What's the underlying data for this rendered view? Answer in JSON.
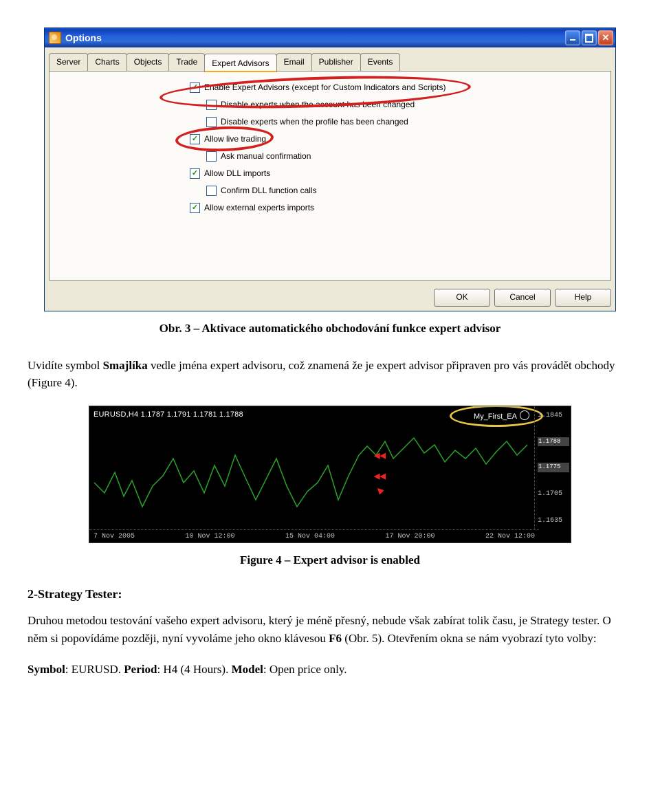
{
  "window": {
    "title": "Options",
    "tabs": [
      "Server",
      "Charts",
      "Objects",
      "Trade",
      "Expert Advisors",
      "Email",
      "Publisher",
      "Events"
    ],
    "active_tab_index": 4,
    "checks": [
      {
        "label": "Enable Expert Advisors (except for Custom Indicators and Scripts)",
        "checked": true,
        "indent": false
      },
      {
        "label": "Disable experts when the account has been changed",
        "checked": false,
        "indent": true
      },
      {
        "label": "Disable experts when the profile has been changed",
        "checked": false,
        "indent": true
      },
      {
        "label": "Allow live trading",
        "checked": true,
        "indent": false
      },
      {
        "label": "Ask manual confirmation",
        "checked": false,
        "indent": true
      },
      {
        "label": "Allow DLL imports",
        "checked": true,
        "indent": false
      },
      {
        "label": "Confirm DLL function calls",
        "checked": false,
        "indent": true
      },
      {
        "label": "Allow external experts imports",
        "checked": true,
        "indent": false
      }
    ],
    "buttons": {
      "ok": "OK",
      "cancel": "Cancel",
      "help": "Help"
    }
  },
  "caption3": "Obr. 3 – Aktivace automatického obchodování funkce expert advisor",
  "para1_a": "Uvidíte symbol ",
  "para1_b": "Smajlíka",
  "para1_c": " vedle jména expert advisoru, což znamená že je expert advisor připraven pro vás provádět obchody (Figure 4).",
  "chart": {
    "header": "EURUSD,H4  1.1787 1.1791 1.1781 1.1788",
    "ea": "My_First_EA",
    "yticks": [
      "1.1845",
      "1.1788",
      "1.1775",
      "1.1705",
      "1.1635"
    ],
    "xticks": [
      "7 Nov 2005",
      "10 Nov 12:00",
      "15 Nov 04:00",
      "17 Nov 20:00",
      "22 Nov 12:00"
    ]
  },
  "caption4": "Figure 4 – Expert advisor is enabled",
  "section2_title": "2-Strategy Tester:",
  "para2": "Druhou metodou testování vašeho expert advisoru, který je méně přesný, nebude však zabírat tolik času, je Strategy tester. O něm si popovídáme později, nyní vyvoláme jeho okno klávesou ",
  "para2_b": "F6",
  "para2_c": " (Obr. 5). Otevřením okna se nám vyobrazí tyto volby:",
  "para3_a": "Symbol",
  "para3_b": ": EURUSD. ",
  "para3_c": "Period",
  "para3_d": ": H4 (4 Hours). ",
  "para3_e": "Model",
  "para3_f": ": Open price only."
}
